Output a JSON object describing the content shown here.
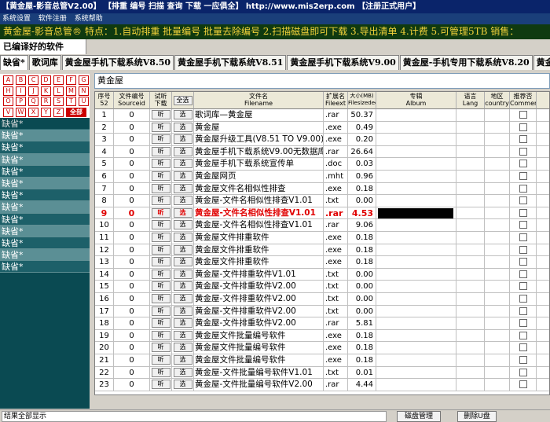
{
  "window": {
    "title": "【黄金屋-影音总管V2.00】  【排重 编号 扫描 查询 下载 一应俱全】  http://www.mis2erp.com   【注册正式用户】"
  },
  "menu": [
    "系统设置",
    "软件注册",
    "系统帮助"
  ],
  "marquee": "黄金屋-影音总管®  特点：1.自动排重 批量编号 批量去除编号 2.扫描磁盘即可下载 3.导出清单 4.计费 5.可管理5TB 销售：",
  "subtitle": "已编译好的软件",
  "tabs": [
    "缺省*",
    "歌词库",
    "黄金屋手机下载系统V8.50",
    "黄金屋手机下载系统V8.51",
    "黄金屋手机下载系统V9.00",
    "黄金屋-手机专用下载系统V8.20",
    "黄金屋-"
  ],
  "letters": [
    "A",
    "B",
    "C",
    "D",
    "E",
    "F",
    "G",
    "H",
    "I",
    "J",
    "K",
    "L",
    "M",
    "N",
    "O",
    "P",
    "Q",
    "R",
    "S",
    "T",
    "U",
    "V",
    "W",
    "X",
    "Y",
    "Z"
  ],
  "letter_all": "全部",
  "sidebar": [
    "缺省*",
    "缺省*",
    "缺省*",
    "缺省*",
    "缺省*",
    "缺省*",
    "缺省*",
    "缺省*",
    "缺省*",
    "缺省*",
    "缺省*",
    "缺省*",
    "缺省*"
  ],
  "search_value": "黄金屋",
  "headers": {
    "seq": "序号",
    "seq_count": "52",
    "src": "文件编号",
    "src_en": "Sourceid",
    "listen": "试听",
    "download": "下载",
    "select_all": "全选",
    "name": "文件名",
    "name_en": "Filename",
    "ext": "扩展名",
    "ext_en": "Fileext",
    "size": "大小(MB)",
    "size_en": "Filesizedec",
    "album": "专辑",
    "album_en": "Album",
    "lang": "语言",
    "lang_en": "Lang",
    "country": "地区",
    "country_en": "country",
    "cmd": "推荐否",
    "cmd_en": "Commend"
  },
  "btn_listen": "听",
  "btn_select": "选",
  "rows": [
    {
      "seq": "1",
      "src": "0",
      "name": "歌词库—黄金屋",
      "ext": ".rar",
      "size": "50.37"
    },
    {
      "seq": "2",
      "src": "0",
      "name": "黄金屋",
      "ext": ".exe",
      "size": "0.49"
    },
    {
      "seq": "3",
      "src": "0",
      "name": "黄金屋升级工具(V8.51 TO V9.00)",
      "ext": ".exe",
      "size": "0.20"
    },
    {
      "seq": "4",
      "src": "0",
      "name": "黄金屋手机下载系统V9.00无数据库",
      "ext": ".rar",
      "size": "26.64"
    },
    {
      "seq": "5",
      "src": "0",
      "name": "黄金屋手机下载系统宣传单",
      "ext": ".doc",
      "size": "0.03"
    },
    {
      "seq": "6",
      "src": "0",
      "name": "黄金屋网页",
      "ext": ".mht",
      "size": "0.96"
    },
    {
      "seq": "7",
      "src": "0",
      "name": "黄金屋文件名相似性排查",
      "ext": ".exe",
      "size": "0.18"
    },
    {
      "seq": "8",
      "src": "0",
      "name": "黄金屋-文件名相似性排查V1.01",
      "ext": ".txt",
      "size": "0.00"
    },
    {
      "seq": "9",
      "src": "0",
      "name": "黄金屋-文件名相似性排查V1.01",
      "ext": ".rar",
      "size": "4.53"
    },
    {
      "seq": "10",
      "src": "0",
      "name": "黄金屋-文件名相似性排查V1.01",
      "ext": ".rar",
      "size": "9.06"
    },
    {
      "seq": "11",
      "src": "0",
      "name": "黄金屋文件排重软件",
      "ext": ".exe",
      "size": "0.18"
    },
    {
      "seq": "12",
      "src": "0",
      "name": "黄金屋文件排重软件",
      "ext": ".exe",
      "size": "0.18"
    },
    {
      "seq": "13",
      "src": "0",
      "name": "黄金屋文件排重软件",
      "ext": ".exe",
      "size": "0.18"
    },
    {
      "seq": "14",
      "src": "0",
      "name": "黄金屋-文件排重软件V1.01",
      "ext": ".txt",
      "size": "0.00"
    },
    {
      "seq": "15",
      "src": "0",
      "name": "黄金屋-文件排重软件V2.00",
      "ext": ".txt",
      "size": "0.00"
    },
    {
      "seq": "16",
      "src": "0",
      "name": "黄金屋-文件排重软件V2.00",
      "ext": ".txt",
      "size": "0.00"
    },
    {
      "seq": "17",
      "src": "0",
      "name": "黄金屋-文件排重软件V2.00",
      "ext": ".txt",
      "size": "0.00"
    },
    {
      "seq": "18",
      "src": "0",
      "name": "黄金屋-文件排重软件V2.00",
      "ext": ".rar",
      "size": "5.81"
    },
    {
      "seq": "19",
      "src": "0",
      "name": "黄金屋文件批量编号软件",
      "ext": ".exe",
      "size": "0.18"
    },
    {
      "seq": "20",
      "src": "0",
      "name": "黄金屋文件批量编号软件",
      "ext": ".exe",
      "size": "0.18"
    },
    {
      "seq": "21",
      "src": "0",
      "name": "黄金屋文件批量编号软件",
      "ext": ".exe",
      "size": "0.18"
    },
    {
      "seq": "22",
      "src": "0",
      "name": "黄金屋-文件批量编号软件V1.01",
      "ext": ".txt",
      "size": "0.01"
    },
    {
      "seq": "23",
      "src": "0",
      "name": "黄金屋-文件批量编号软件V2.00",
      "ext": ".rar",
      "size": "4.44"
    }
  ],
  "highlight_row": 9,
  "status": {
    "text": "结果全部显示",
    "disk_btn": "磁盘管理",
    "delete_btn": "删除U盘"
  }
}
